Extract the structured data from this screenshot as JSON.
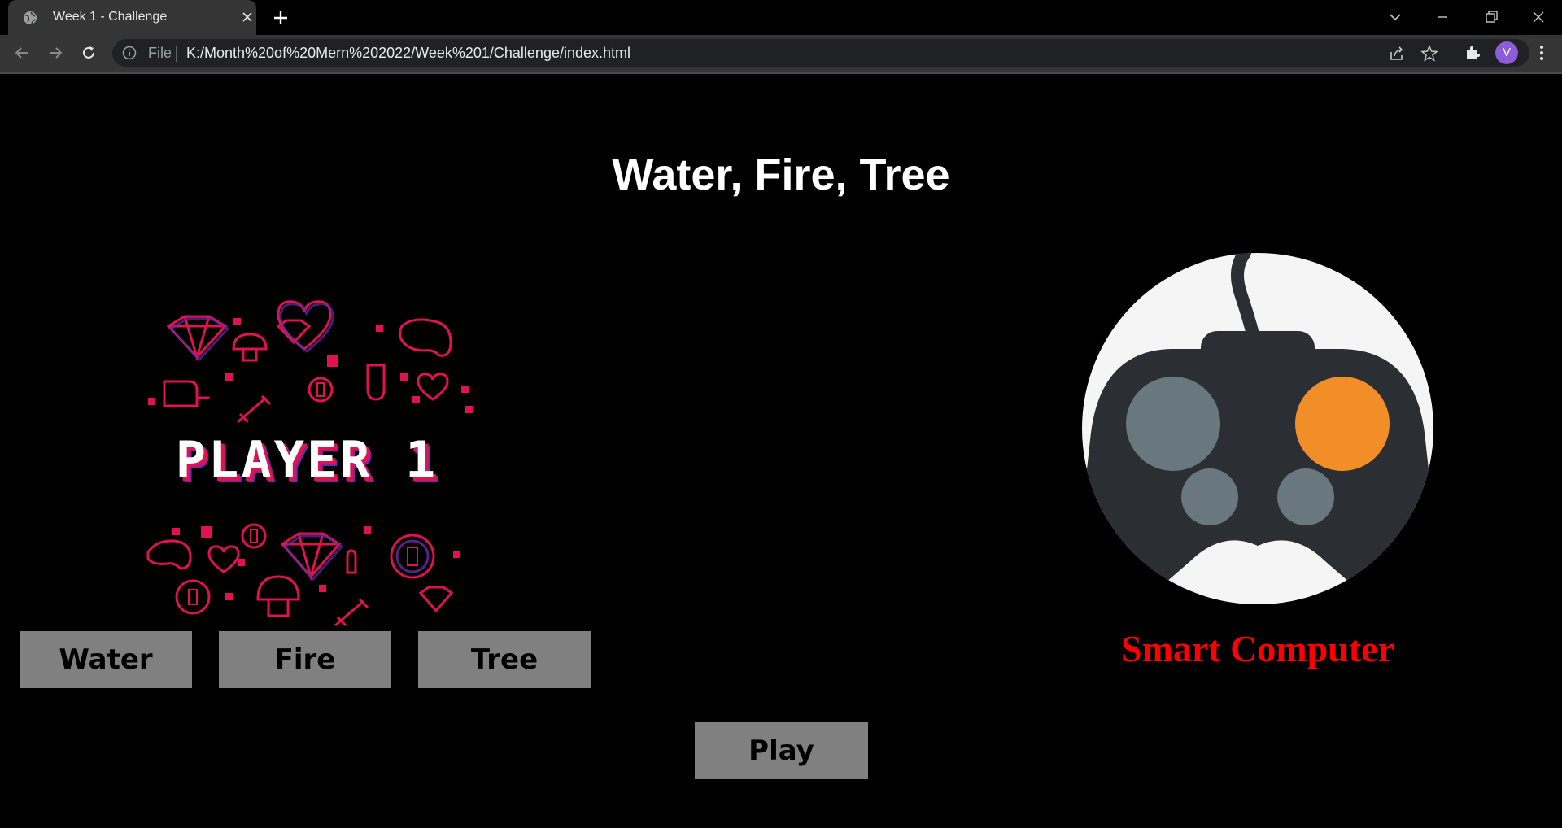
{
  "browser": {
    "tab_title": "Week 1 - Challenge",
    "url_scheme": "File",
    "url": "K:/Month%20of%20Mern%202022/Week%201/Challenge/index.html",
    "profile_initial": "V",
    "profile_color": "#8e5cd9"
  },
  "page": {
    "title": "Water, Fire, Tree",
    "player_image_text": "PLAYER 1",
    "choices": [
      "Water",
      "Fire",
      "Tree"
    ],
    "play_label": "Play",
    "computer_label": "Smart Computer",
    "colors": {
      "button_bg": "#808080",
      "computer_label": "#ff0000",
      "accent_orange": "#f28e27"
    }
  }
}
